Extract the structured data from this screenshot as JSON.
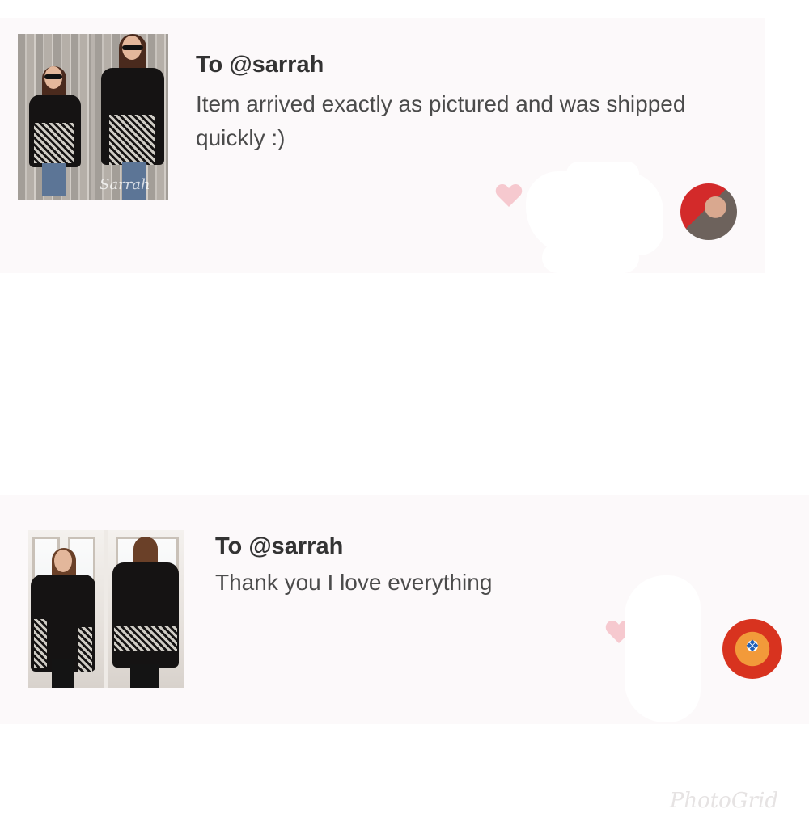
{
  "reviews": [
    {
      "recipient": "To @sarrah",
      "message": "Item arrived exactly as pictured and was shipped quickly :)",
      "thumbnail_icon": "listing-photo-collage",
      "photo_watermark": "Sarrah",
      "like_icon": "heart-icon",
      "avatar_icon": "reviewer-avatar-photo"
    },
    {
      "recipient": "To @sarrah",
      "message": "Thank you I love everything",
      "thumbnail_icon": "listing-photo-collage",
      "like_icon": "heart-icon",
      "avatar_icon": "reviewer-avatar-logo"
    }
  ],
  "colors": {
    "card_background": "#fcf9fa",
    "heart": "#f6c9cf",
    "title_text": "#333333",
    "message_text": "#4b4b4b"
  },
  "watermark": "PhotoGrid"
}
